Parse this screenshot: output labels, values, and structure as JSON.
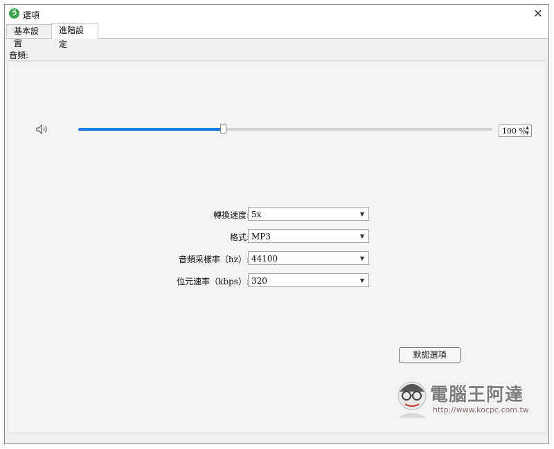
{
  "window": {
    "title": "選項",
    "close_glyph": "✕",
    "app_icon_letter": "う"
  },
  "tabs": [
    {
      "label": "基本設置",
      "active": false
    },
    {
      "label": "進階設定",
      "active": true
    }
  ],
  "audio_group": {
    "label": "音頻:",
    "volume": {
      "value_percent": 35,
      "display": "100 %",
      "spin_up": "▲",
      "spin_down": "▼"
    },
    "settings": [
      {
        "label": "轉換速度:",
        "value": "5x"
      },
      {
        "label": "格式:",
        "value": "MP3"
      },
      {
        "label": "音頻采樣率（hz）:",
        "value": "44100"
      },
      {
        "label": "位元速率（kbps）:",
        "value": "320"
      }
    ],
    "caret": "▼",
    "default_button": "默認選項"
  },
  "watermark": {
    "title": "電腦王阿達",
    "url": "http://www.kocpc.com.tw"
  },
  "icons": {
    "app": "app-logo-icon",
    "close": "close-icon",
    "speaker": "speaker-icon",
    "dropdown": "chevron-down-icon"
  },
  "colors": {
    "accent": "#1e7bd7",
    "app_icon": "#3aa24a"
  }
}
